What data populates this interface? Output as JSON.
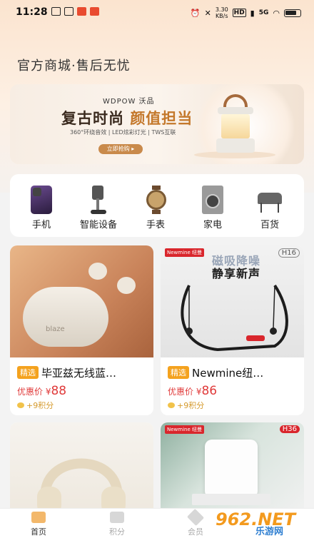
{
  "status_bar": {
    "time": "11:28",
    "speed_value": "3.30",
    "speed_unit": "KB/s",
    "hd": "HD",
    "network": "5G",
    "battery_icon": "battery-icon"
  },
  "slogan": "官方商城·售后无忧",
  "banner": {
    "brand": "WDPOW 沃品",
    "headline_a": "复古时尚 ",
    "headline_b": "颜值担当",
    "subtitle": "360°环绕音效 | LED炫彩灯光 | TWS互联",
    "cta": "立即抢购 ▸"
  },
  "categories": [
    {
      "label": "手机",
      "icon": "phone-icon"
    },
    {
      "label": "智能设备",
      "icon": "vacuum-icon"
    },
    {
      "label": "手表",
      "icon": "watch-icon"
    },
    {
      "label": "家电",
      "icon": "washer-icon"
    },
    {
      "label": "百货",
      "icon": "chair-icon"
    }
  ],
  "products": [
    {
      "tag": "精选",
      "title": "毕亚兹无线蓝…",
      "price_label": "优惠价",
      "currency": "¥",
      "price": "88",
      "points": "+9积分",
      "image_text": "blaze"
    },
    {
      "tag": "精选",
      "title": "Newmine纽…",
      "price_label": "优惠价",
      "currency": "¥",
      "price": "86",
      "points": "+9积分",
      "brand": "Newmine 纽曼",
      "model": "H16",
      "headline_1": "磁吸降噪",
      "headline_2": "静享新声"
    },
    {
      "brand": "Newmine 纽曼",
      "model": "H36"
    }
  ],
  "tabs": [
    {
      "label": "首页",
      "active": true
    },
    {
      "label": "积分",
      "active": false
    },
    {
      "label": "会员",
      "active": false
    }
  ],
  "watermark": {
    "num": "962.NET",
    "cn": "乐游网"
  },
  "colors": {
    "accent": "#f4a21e",
    "price": "#e03a3a",
    "banner_highlight": "#c4782b"
  }
}
